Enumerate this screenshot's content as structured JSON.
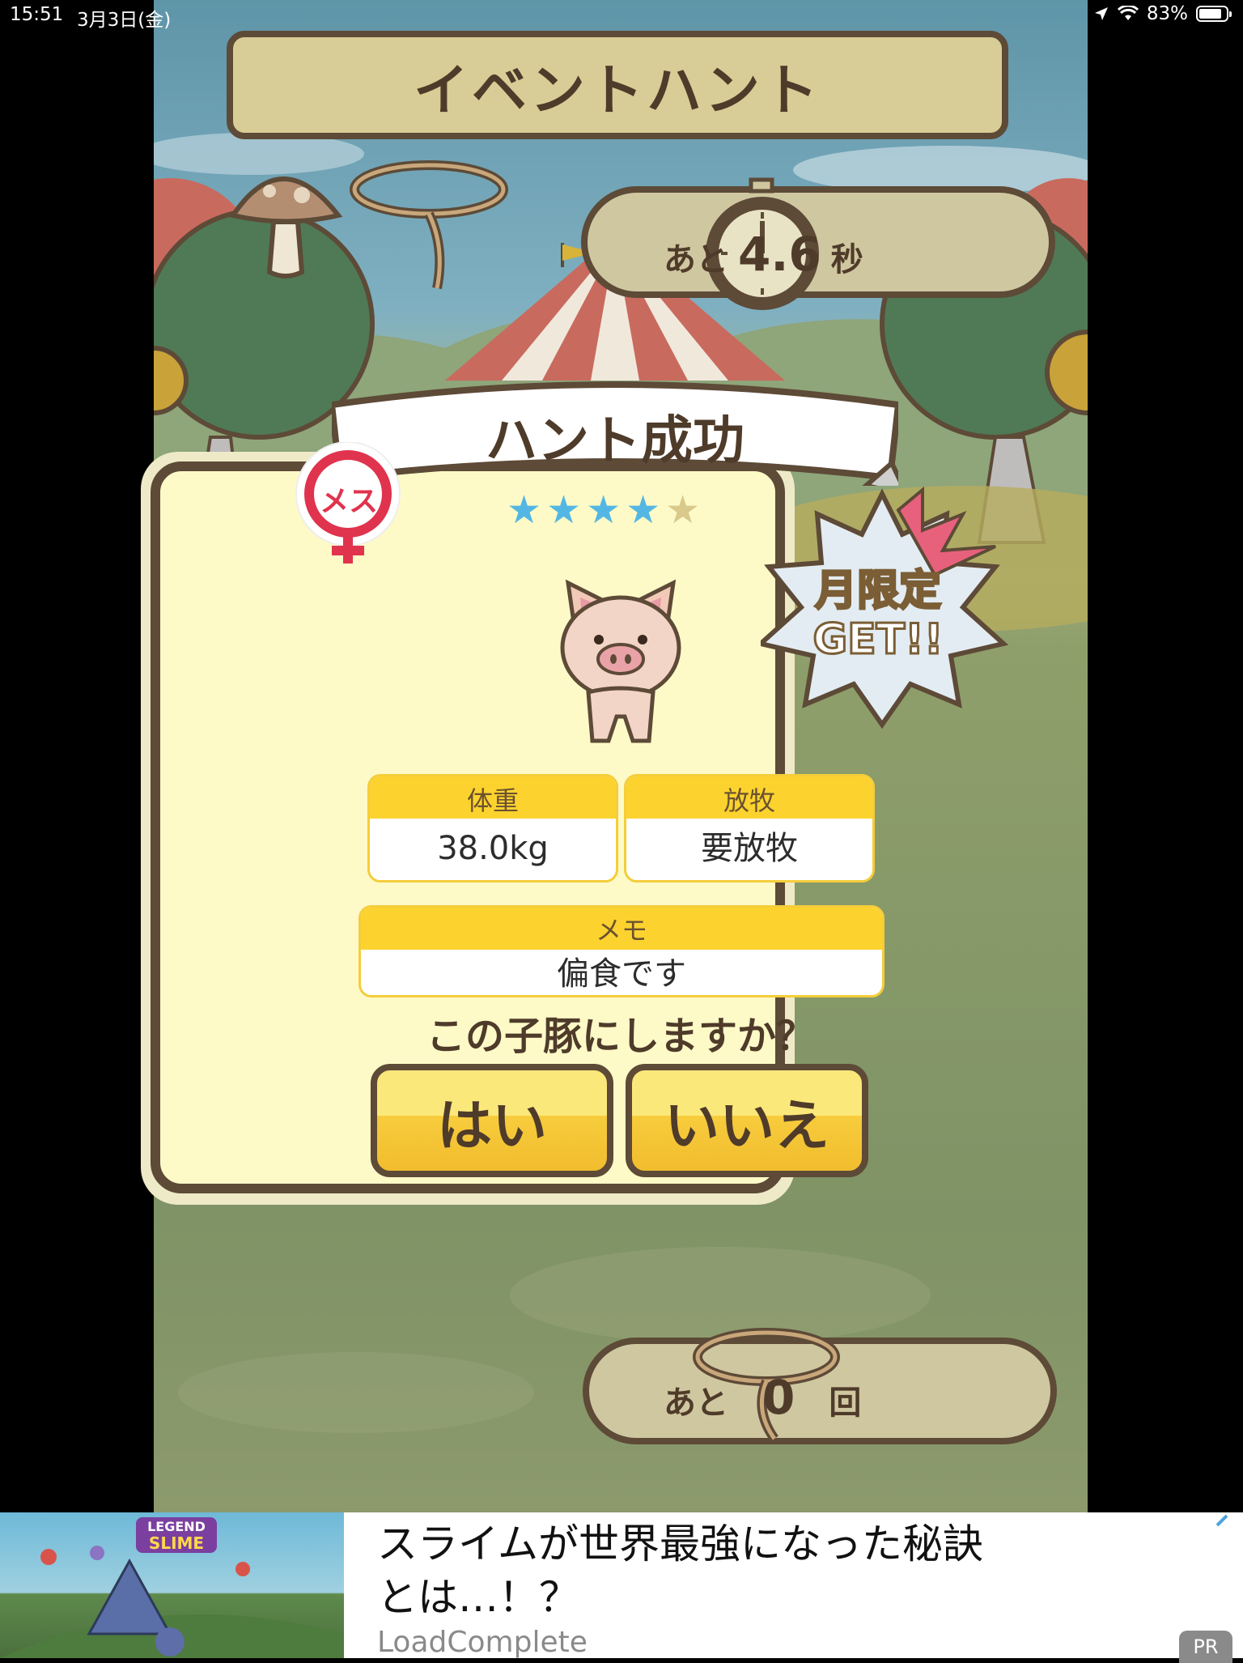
{
  "status_bar": {
    "time": "15:51",
    "date": "3月3日(金)",
    "battery": "83%",
    "battery_level": 0.83
  },
  "game": {
    "title": "イベントハント",
    "timer": {
      "prefix": "あと",
      "value": "4.6",
      "unit": "秒"
    },
    "attempts": {
      "prefix": "あと",
      "value": "0",
      "unit": "回"
    },
    "result": {
      "heading": "ハント成功",
      "gender_badge": "メス",
      "stars_filled": 4,
      "stars_total": 5,
      "burst_line1": "月限定",
      "burst_line2": "GET!!",
      "weight": {
        "label": "体重",
        "value": "38.0kg"
      },
      "grazing": {
        "label": "放牧",
        "value": "要放牧"
      },
      "memo": {
        "label": "メモ",
        "value": "偏食です"
      },
      "question": "この子豚にしますか？",
      "yes_label": "はい",
      "no_label": "いいえ"
    }
  },
  "ad": {
    "title_line1": "スライムが世界最強になった秘訣",
    "title_line2": "とは…！？",
    "source": "LoadComplete",
    "badge": "PR",
    "game_logo_line1": "LEGEND",
    "game_logo_line2": "SLIME"
  },
  "colors": {
    "wood_border": "#5d4a37",
    "card_bg": "#fdfac8",
    "button_yellow": "#f7cc3d",
    "star_blue": "#54b7e3",
    "badge_red": "#e0334d"
  }
}
